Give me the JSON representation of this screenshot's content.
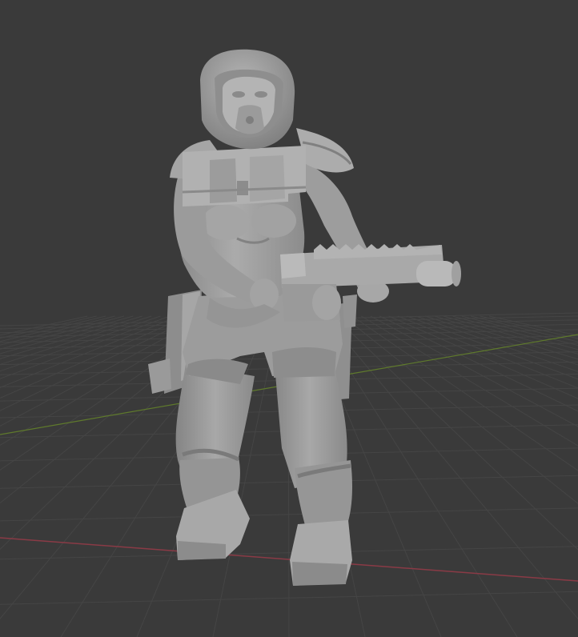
{
  "viewport": {
    "background_color": "#3a3a3a",
    "grid_line_color": "#454545",
    "x_axis_color": "#8a3a46",
    "y_axis_color": "#5f7a2c"
  },
  "model": {
    "name": "miniature-soldier",
    "base_color": "#9e9e9e",
    "shade_color": "#7a7a7a",
    "highlight_color": "#bcbcbc"
  }
}
